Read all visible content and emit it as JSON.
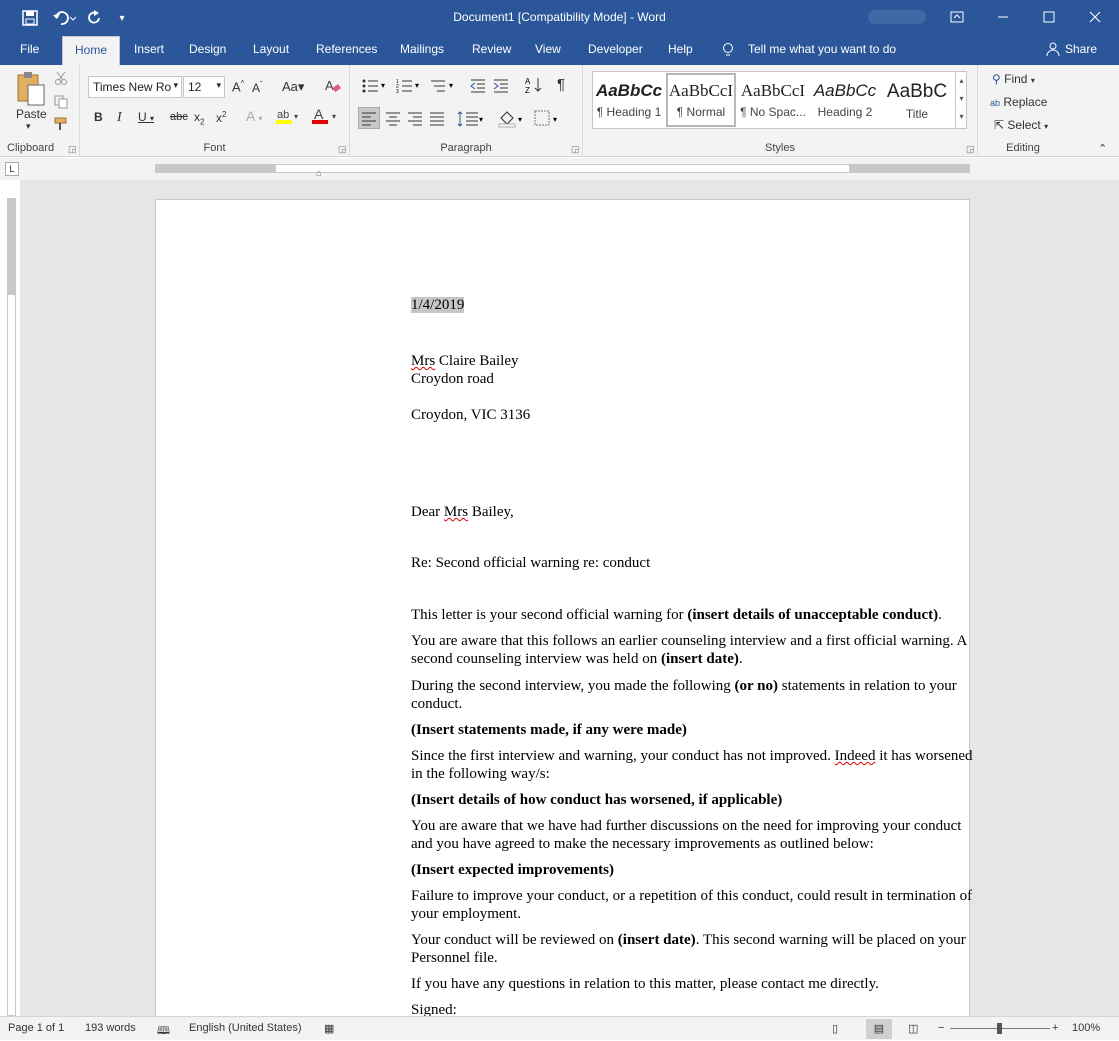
{
  "titlebar": {
    "title": "Document1 [Compatibility Mode]  -  Word"
  },
  "tabs": [
    "File",
    "Home",
    "Insert",
    "Design",
    "Layout",
    "References",
    "Mailings",
    "Review",
    "View",
    "Developer",
    "Help"
  ],
  "tellme": "Tell me what you want to do",
  "share": "Share",
  "ribbon": {
    "clipboard": {
      "label": "Clipboard",
      "paste": "Paste"
    },
    "font": {
      "label": "Font",
      "name": "Times New Ro",
      "size": "12"
    },
    "paragraph": {
      "label": "Paragraph"
    },
    "styles": {
      "label": "Styles",
      "items": [
        {
          "sample": "AaBbCc",
          "name": "¶ Heading 1"
        },
        {
          "sample": "AaBbCcI",
          "name": "¶ Normal"
        },
        {
          "sample": "AaBbCcI",
          "name": "¶ No Spac..."
        },
        {
          "sample": "AaBbCc",
          "name": "Heading 2"
        },
        {
          "sample": "AaBbC",
          "name": "Title"
        }
      ]
    },
    "editing": {
      "label": "Editing",
      "find": "Find",
      "replace": "Replace",
      "select": "Select"
    }
  },
  "doc": {
    "date": "1/4/2019",
    "addr1_mrs": "Mrs",
    "addr1_rest": " Claire Bailey",
    "addr2": "Croydon road",
    "addr3": "Croydon, VIC 3136",
    "dear_a": "Dear ",
    "dear_mrs": "Mrs",
    "dear_b": " Bailey,",
    "re": "Re: Second official warning re: conduct",
    "p1a": "This letter is your second official warning for ",
    "p1b": "(insert details of unacceptable conduct)",
    "p1c": ".",
    "p2a": "You are aware that this follows an earlier counseling interview and a first official warning. A second counseling interview was held on ",
    "p2b": "(insert date)",
    "p2c": ".",
    "p3a": "During the second interview, you made the following ",
    "p3b": "(or no)",
    "p3c": " statements in relation to your conduct.",
    "p4": "(Insert statements made, if any were made)",
    "p5a": "Since the first interview and warning, your conduct has not improved. ",
    "p5b": "Indeed",
    "p5c": " it has worsened in the following way/s:",
    "p6": "(Insert details of how conduct has worsened, if applicable)",
    "p7": "You are aware that we have had further discussions on the need for improving your conduct and you have agreed to make the necessary improvements as outlined below:",
    "p8": "(Insert expected improvements)",
    "p9": "Failure to improve your conduct, or a repetition of this conduct, could result in termination of your employment.",
    "p10a": "Your conduct will be reviewed on ",
    "p10b": "(insert date)",
    "p10c": ". This second warning will be placed on your Personnel file.",
    "p11": "If you have any questions in relation to this matter, please contact me directly.",
    "p12": "Signed:"
  },
  "status": {
    "page": "Page 1 of 1",
    "words": "193 words",
    "language": "English (United States)",
    "zoom": "100%"
  }
}
